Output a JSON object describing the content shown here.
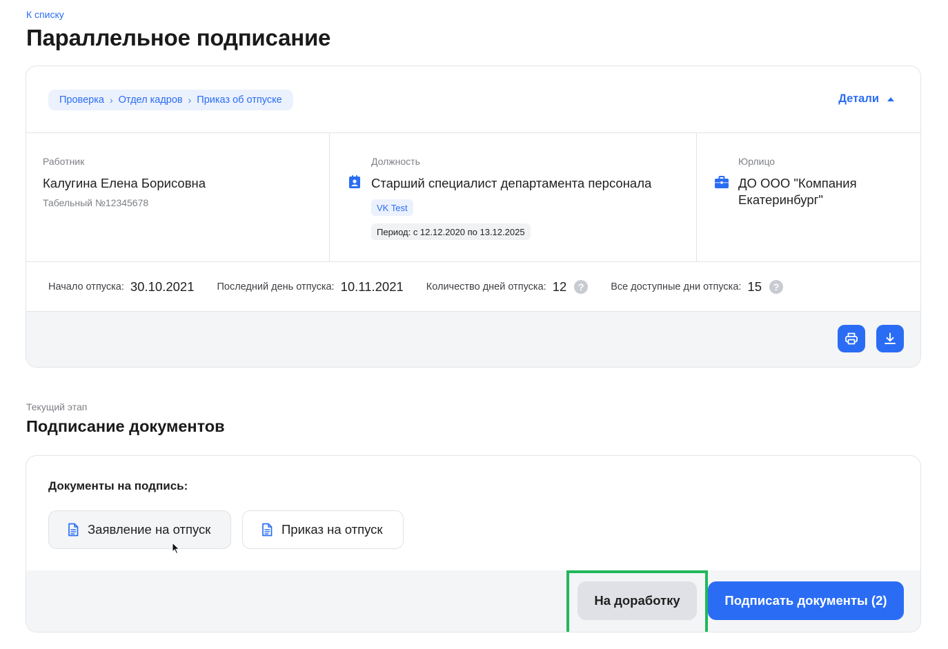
{
  "nav": {
    "back_label": "К списку"
  },
  "page": {
    "title": "Параллельное подписание"
  },
  "breadcrumb": {
    "items": [
      "Проверка",
      "Отдел кадров",
      "Приказ об отпуске"
    ],
    "separator": "›"
  },
  "details": {
    "label": "Детали"
  },
  "employee": {
    "label": "Работник",
    "name": "Калугина Елена Борисовна",
    "tab_number": "Табельный №12345678"
  },
  "position": {
    "label": "Должность",
    "title": "Старший специалист департамента персонала",
    "tag": "VK Test",
    "period": "Период: с 12.12.2020 по 13.12.2025",
    "icon": "badge-icon"
  },
  "entity": {
    "label": "Юрлицо",
    "name": "ДО ООО \"Компания Екатеринбург\"",
    "icon": "briefcase-icon"
  },
  "stats": {
    "start_label": "Начало отпуска:",
    "start_value": "30.10.2021",
    "end_label": "Последний день отпуска:",
    "end_value": "10.11.2021",
    "days_label": "Количество дней отпуска:",
    "days_value": "12",
    "available_label": "Все доступные дни отпуска:",
    "available_value": "15",
    "help_glyph": "?"
  },
  "stage": {
    "label": "Текущий этап",
    "title": "Подписание документов"
  },
  "documents": {
    "title": "Документы на подпись:",
    "items": [
      "Заявление на отпуск",
      "Приказ на отпуск"
    ]
  },
  "actions": {
    "rework_label": "На доработку",
    "sign_label": "Подписать документы (2)"
  },
  "colors": {
    "accent": "#2a6df4",
    "highlight": "#1fb85a",
    "muted": "#7d7f85"
  }
}
